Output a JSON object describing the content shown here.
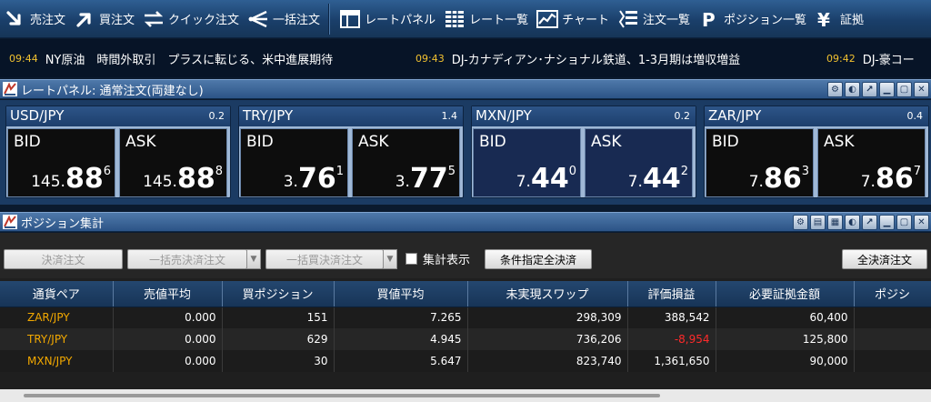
{
  "toolbar": {
    "items": [
      {
        "label": "売注文",
        "icon": "sell-arrow-icon"
      },
      {
        "label": "買注文",
        "icon": "buy-arrow-icon"
      },
      {
        "label": "クイック注文",
        "icon": "quick-order-icon"
      },
      {
        "label": "一括注文",
        "icon": "bulk-order-icon"
      },
      {
        "label": "レートパネル",
        "icon": "rate-panel-icon"
      },
      {
        "label": "レート一覧",
        "icon": "rate-list-icon"
      },
      {
        "label": "チャート",
        "icon": "chart-icon"
      },
      {
        "label": "注文一覧",
        "icon": "order-list-icon"
      },
      {
        "label": "ポジション一覧",
        "icon": "position-list-icon"
      },
      {
        "label": "証拠",
        "icon": "margin-yen-icon"
      }
    ]
  },
  "ticker": [
    {
      "time": "09:44",
      "text": "NY原油　時間外取引　プラスに転じる、米中進展期待"
    },
    {
      "time": "09:43",
      "text": "DJ-カナディアン･ナショナル鉄道、1-3月期は増収増益"
    },
    {
      "time": "09:42",
      "text": "DJ-豪コー"
    }
  ],
  "rate_panel": {
    "title": "レートパネル: 通常注文(両建なし)",
    "cards": [
      {
        "pair": "USD/JPY",
        "spread": "0.2",
        "bid": {
          "label": "BID",
          "small": "145.",
          "big": "88",
          "sup": "6"
        },
        "ask": {
          "label": "ASK",
          "small": "145.",
          "big": "88",
          "sup": "8"
        },
        "blue": false
      },
      {
        "pair": "TRY/JPY",
        "spread": "1.4",
        "bid": {
          "label": "BID",
          "small": "3.",
          "big": "76",
          "sup": "1"
        },
        "ask": {
          "label": "ASK",
          "small": "3.",
          "big": "77",
          "sup": "5"
        },
        "blue": false
      },
      {
        "pair": "MXN/JPY",
        "spread": "0.2",
        "bid": {
          "label": "BID",
          "small": "7.",
          "big": "44",
          "sup": "0"
        },
        "ask": {
          "label": "ASK",
          "small": "7.",
          "big": "44",
          "sup": "2"
        },
        "blue": true
      },
      {
        "pair": "ZAR/JPY",
        "spread": "0.4",
        "bid": {
          "label": "BID",
          "small": "7.",
          "big": "86",
          "sup": "3"
        },
        "ask": {
          "label": "ASK",
          "small": "7.",
          "big": "86",
          "sup": "7"
        },
        "blue": false
      }
    ]
  },
  "position_panel": {
    "title": "ポジション集計",
    "buttons": {
      "settle": "決済注文",
      "bulk_sell_settle": "一括売決済注文",
      "bulk_buy_settle": "一括買決済注文",
      "aggregate_label": "集計表示",
      "conditional_all_settle": "条件指定全決済",
      "all_settle": "全決済注文"
    },
    "columns": [
      "通貨ペア",
      "売値平均",
      "買ポジション",
      "買値平均",
      "未実現スワップ",
      "評価損益",
      "必要証拠金額",
      "ポジシ"
    ],
    "rows": [
      [
        "ZAR/JPY",
        "0.000",
        "151",
        "7.265",
        "298,309",
        "388,542",
        "60,400",
        ""
      ],
      [
        "TRY/JPY",
        "0.000",
        "629",
        "4.945",
        "736,206",
        "-8,954",
        "125,800",
        ""
      ],
      [
        "MXN/JPY",
        "0.000",
        "30",
        "5.647",
        "823,740",
        "1,361,650",
        "90,000",
        ""
      ]
    ]
  },
  "colors": {
    "accent": "#2c5487",
    "pair_text": "#f2a800",
    "loss": "#ff2a2a",
    "ticker_time": "#f2c230"
  }
}
